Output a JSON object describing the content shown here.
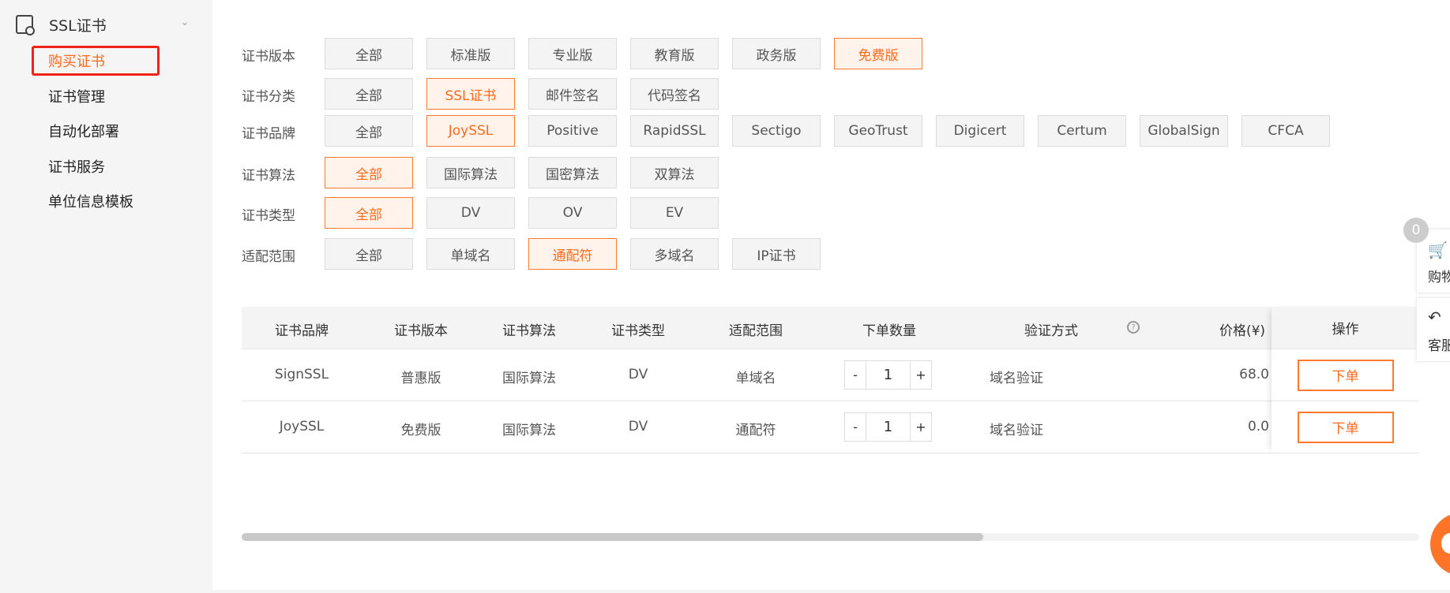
{
  "sidebar": {
    "group": "SSL证书",
    "items": [
      "购买证书",
      "证书管理",
      "自动化部署",
      "证书服务",
      "单位信息模板"
    ]
  },
  "filters": [
    {
      "label": "证书版本",
      "options": [
        "全部",
        "标准版",
        "专业版",
        "教育版",
        "政务版",
        "免费版"
      ],
      "selected": 5
    },
    {
      "label": "证书分类",
      "options": [
        "全部",
        "SSL证书",
        "邮件签名",
        "代码签名"
      ],
      "selected": 1
    },
    {
      "label": "证书品牌",
      "options": [
        "全部",
        "JoySSL",
        "Positive",
        "RapidSSL",
        "Sectigo",
        "GeoTrust",
        "Digicert",
        "Certum",
        "GlobalSign",
        "CFCA"
      ],
      "selected": 1
    },
    {
      "label": "证书算法",
      "options": [
        "全部",
        "国际算法",
        "国密算法",
        "双算法"
      ],
      "selected": 0
    },
    {
      "label": "证书类型",
      "options": [
        "全部",
        "DV",
        "OV",
        "EV"
      ],
      "selected": 0
    },
    {
      "label": "适配范围",
      "options": [
        "全部",
        "单域名",
        "通配符",
        "多域名",
        "IP证书"
      ],
      "selected": 2
    }
  ],
  "table": {
    "headers": [
      "证书品牌",
      "证书版本",
      "证书算法",
      "证书类型",
      "适配范围",
      "下单数量",
      "验证方式",
      "价格(¥)",
      "操作"
    ],
    "rows": [
      {
        "brand": "SignSSL",
        "version": "普惠版",
        "algo": "国际算法",
        "type": "DV",
        "scope": "单域名",
        "qty": "1",
        "verify": "域名验证",
        "price": "68.0",
        "action": "下单"
      },
      {
        "brand": "JoySSL",
        "version": "免费版",
        "algo": "国际算法",
        "type": "DV",
        "scope": "通配符",
        "qty": "1",
        "verify": "域名验证",
        "price": "0.0",
        "action": "下单"
      }
    ],
    "minus": "-",
    "plus": "+"
  },
  "scroll_fraction": 0.63,
  "float": {
    "cart_count": "0",
    "cart_label": "购物车",
    "service_label": "客服"
  },
  "colors": {
    "accent": "#ff6a1a",
    "highlight": "#f0221a"
  }
}
